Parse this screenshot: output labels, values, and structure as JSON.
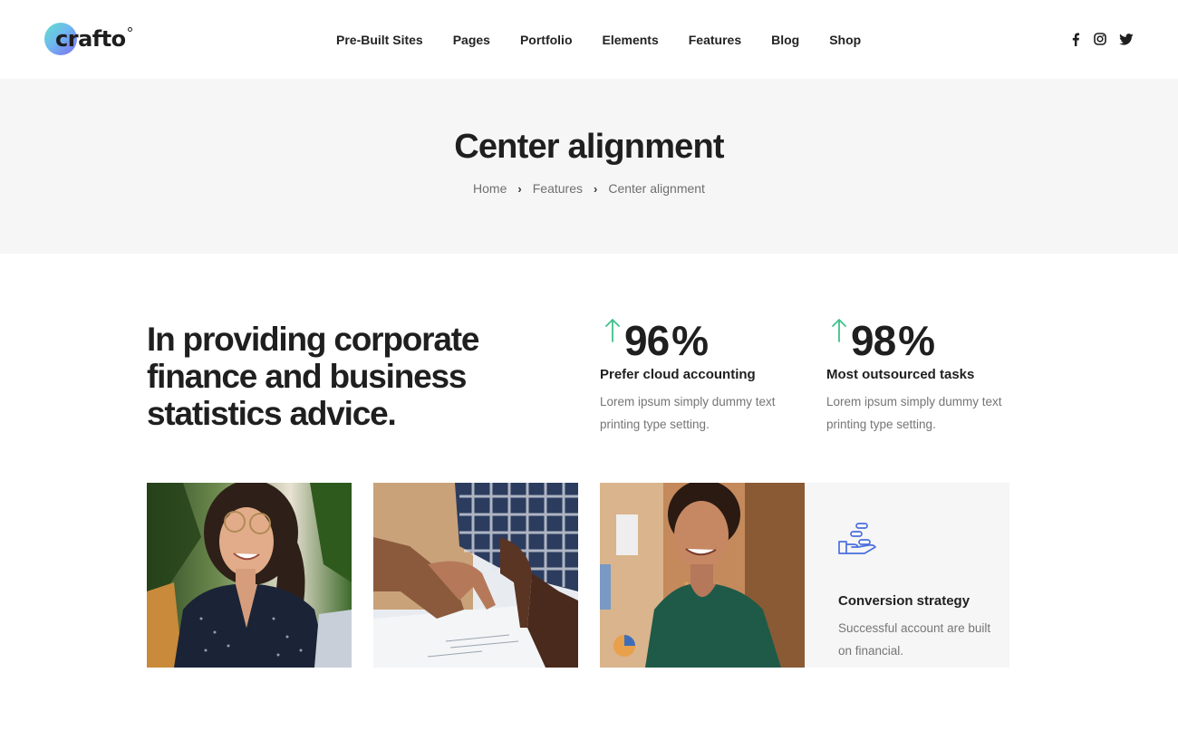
{
  "header": {
    "logo_text": "crafto",
    "nav": [
      {
        "label": "Pre-Built Sites"
      },
      {
        "label": "Pages"
      },
      {
        "label": "Portfolio"
      },
      {
        "label": "Elements"
      },
      {
        "label": "Features"
      },
      {
        "label": "Blog"
      },
      {
        "label": "Shop"
      }
    ],
    "social_icons": [
      "facebook-icon",
      "instagram-icon",
      "twitter-icon"
    ]
  },
  "title_band": {
    "title": "Center alignment",
    "breadcrumb": [
      {
        "label": "Home"
      },
      {
        "label": "Features"
      },
      {
        "label": "Center alignment"
      }
    ]
  },
  "intro": {
    "headline": "In providing corporate finance and business statistics advice."
  },
  "stats": [
    {
      "value": "96",
      "unit": "%",
      "title": "Prefer cloud accounting",
      "description": "Lorem ipsum simply dummy text printing type setting.",
      "icon": "arrow-up-icon"
    },
    {
      "value": "98",
      "unit": "%",
      "title": "Most outsourced tasks",
      "description": "Lorem ipsum simply dummy text printing type setting.",
      "icon": "arrow-up-icon"
    }
  ],
  "cards": {
    "info": {
      "icon": "hand-coins-icon",
      "title": "Conversion strategy",
      "description": "Successful account are built on financial."
    }
  },
  "colors": {
    "accent_green": "#3ec18b",
    "icon_blue": "#4a6fe0",
    "band_bg": "#f6f6f6",
    "text_dark": "#1f1f1f",
    "text_muted": "#757575"
  }
}
